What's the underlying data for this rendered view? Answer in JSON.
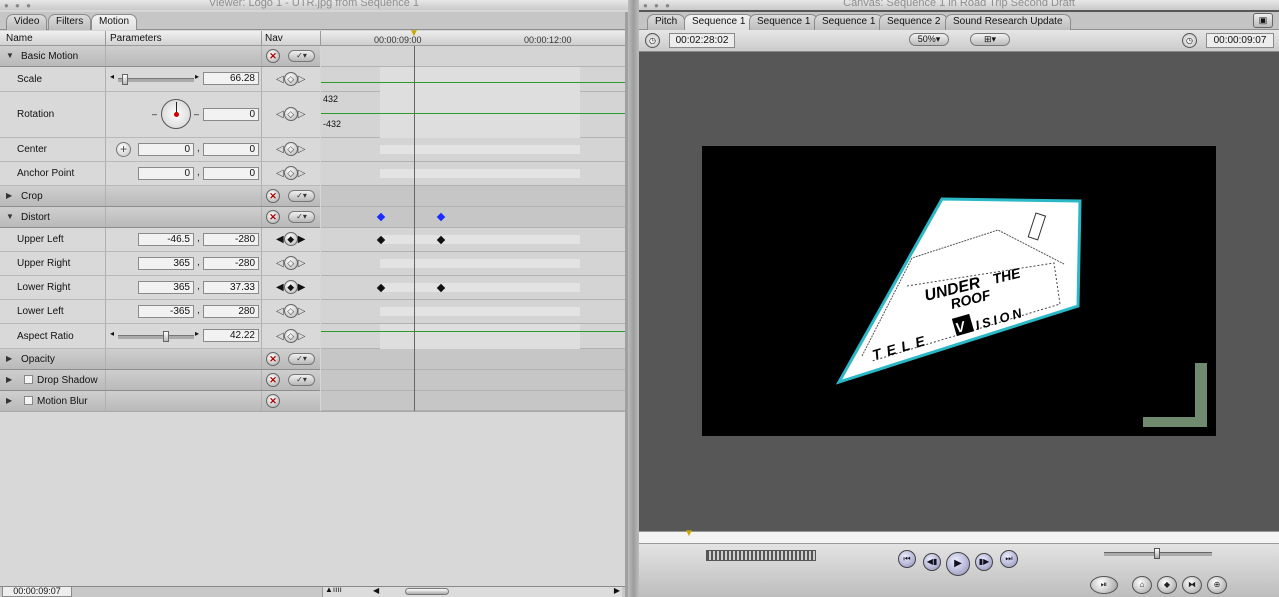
{
  "viewer": {
    "title": "Viewer: Logo 1 - UTR.jpg from Sequence 1",
    "tabs": [
      {
        "label": "Video"
      },
      {
        "label": "Filters"
      },
      {
        "label": "Motion"
      }
    ],
    "columns": {
      "name": "Name",
      "parameters": "Parameters",
      "nav": "Nav"
    },
    "ruler": {
      "tc1": "00:00:09:00",
      "tc2": "00:00:12:00"
    },
    "graph_labels": {
      "rot_max": "432",
      "rot_min": "-432"
    },
    "rows": {
      "basic_motion": "Basic Motion",
      "scale": {
        "label": "Scale",
        "value": "66.28"
      },
      "rotation": {
        "label": "Rotation",
        "value": "0"
      },
      "center": {
        "label": "Center",
        "x": "0",
        "y": "0"
      },
      "anchor": {
        "label": "Anchor Point",
        "x": "0",
        "y": "0"
      },
      "crop": "Crop",
      "distort": "Distort",
      "upper_left": {
        "label": "Upper Left",
        "x": "-46.5",
        "y": "-280"
      },
      "upper_right": {
        "label": "Upper Right",
        "x": "365",
        "y": "-280"
      },
      "lower_right": {
        "label": "Lower Right",
        "x": "365",
        "y": "37.33"
      },
      "lower_left": {
        "label": "Lower Left",
        "x": "-365",
        "y": "280"
      },
      "aspect": {
        "label": "Aspect Ratio",
        "value": "42.22"
      },
      "opacity": "Opacity",
      "drop_shadow": "Drop Shadow",
      "motion_blur": "Motion Blur"
    },
    "timecode": "00:00:09:07"
  },
  "canvas": {
    "title": "Canvas: Sequence 1 in Road Trip Second Draft",
    "tabs": [
      {
        "label": "Pitch"
      },
      {
        "label": "Sequence 1"
      },
      {
        "label": "Sequence 1"
      },
      {
        "label": "Sequence 1"
      },
      {
        "label": "Sequence 2"
      },
      {
        "label": "Sound Research Update"
      }
    ],
    "duration": "00:02:28:02",
    "zoom": "50%",
    "current_tc": "00:00:09:07",
    "logo": {
      "line1": "UNDER",
      "line1b": "THE",
      "line2": "ROOF",
      "line3a": "TELE",
      "line3b": "V",
      "line3c": "ISION"
    },
    "colors": {
      "logo_border": "#2bb8c6",
      "safe_area": "#6f8a6f",
      "frame_bg": "#000000"
    }
  }
}
